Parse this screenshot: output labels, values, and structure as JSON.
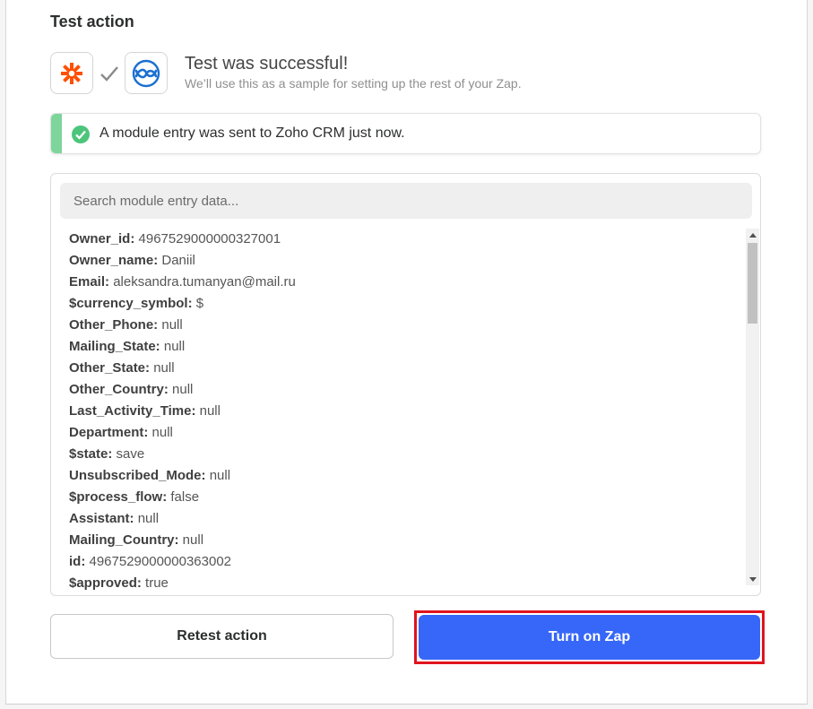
{
  "section": {
    "title": "Test action"
  },
  "apps": {
    "left_icon": "zapier-asterisk-icon",
    "middle_icon": "checkmark-icon",
    "right_icon": "zoho-crm-icon"
  },
  "result": {
    "title": "Test was successful!",
    "subtitle": "We’ll use this as a sample for setting up the rest of your Zap."
  },
  "alert": {
    "icon": "check-circle-icon",
    "text": "A module entry was sent to Zoho CRM just now.",
    "accent": "#7ed59b"
  },
  "search": {
    "placeholder": "Search module entry data..."
  },
  "entries": [
    {
      "key": "Owner_id:",
      "value": "4967529000000327001"
    },
    {
      "key": "Owner_name:",
      "value": "Daniil"
    },
    {
      "key": "Email:",
      "value": "aleksandra.tumanyan@mail.ru"
    },
    {
      "key": "$currency_symbol:",
      "value": "$"
    },
    {
      "key": "Other_Phone:",
      "value": "null"
    },
    {
      "key": "Mailing_State:",
      "value": "null"
    },
    {
      "key": "Other_State:",
      "value": "null"
    },
    {
      "key": "Other_Country:",
      "value": "null"
    },
    {
      "key": "Last_Activity_Time:",
      "value": "null"
    },
    {
      "key": "Department:",
      "value": "null"
    },
    {
      "key": "$state:",
      "value": "save"
    },
    {
      "key": "Unsubscribed_Mode:",
      "value": "null"
    },
    {
      "key": "$process_flow:",
      "value": "false"
    },
    {
      "key": "Assistant:",
      "value": "null"
    },
    {
      "key": "Mailing_Country:",
      "value": "null"
    },
    {
      "key": "id:",
      "value": "4967529000000363002"
    },
    {
      "key": "$approved:",
      "value": "true"
    }
  ],
  "buttons": {
    "retest": "Retest action",
    "turn_on": "Turn on Zap"
  },
  "colors": {
    "primary": "#3767f8",
    "highlight": "#e0141e",
    "zapier": "#ff4f00",
    "zoho": "#1a6fd1"
  }
}
